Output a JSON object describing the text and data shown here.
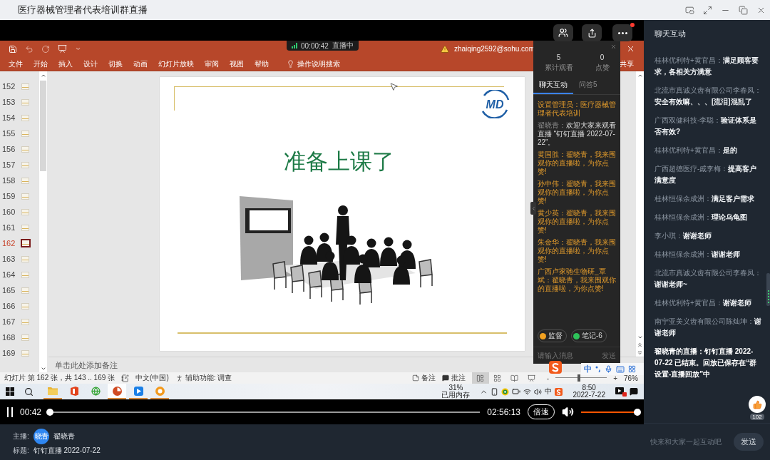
{
  "window": {
    "title": "医疗器械管理者代表培训群直播"
  },
  "video": {
    "more_unread": true,
    "live_badge": {
      "time": "00:00:42",
      "status": "直播中"
    },
    "ppt": {
      "account": "zhaiqing2592@sohu.com",
      "ribbon_tabs": [
        "文件",
        "开始",
        "插入",
        "设计",
        "切换",
        "动画",
        "幻灯片放映",
        "审阅",
        "视图",
        "帮助"
      ],
      "tell_me": "操作说明搜索",
      "share": "共享",
      "slides": [
        {
          "number": "152",
          "selected": false
        },
        {
          "number": "153",
          "selected": false
        },
        {
          "number": "154",
          "selected": false
        },
        {
          "number": "155",
          "selected": false
        },
        {
          "number": "156",
          "selected": false
        },
        {
          "number": "157",
          "selected": false
        },
        {
          "number": "158",
          "selected": false
        },
        {
          "number": "159",
          "selected": false
        },
        {
          "number": "160",
          "selected": false
        },
        {
          "number": "161",
          "selected": false
        },
        {
          "number": "162",
          "selected": true
        },
        {
          "number": "163",
          "selected": false
        },
        {
          "number": "164",
          "selected": false
        },
        {
          "number": "165",
          "selected": false
        },
        {
          "number": "166",
          "selected": false
        },
        {
          "number": "167",
          "selected": false
        },
        {
          "number": "168",
          "selected": false
        },
        {
          "number": "169",
          "selected": false
        }
      ],
      "slide": {
        "logo": "MD",
        "title": "准备上课了"
      },
      "notes_placeholder": "单击此处添加备注",
      "status": {
        "slide_info": "幻灯片 第 162 张，共 143 .. 169 张",
        "language": "中文(中国)",
        "accessibility": "辅助功能: 调查",
        "notes": "备注",
        "comments": "批注",
        "views": [
          {
            "kind": "normal",
            "selected": true
          },
          {
            "kind": "sorter",
            "selected": false
          },
          {
            "kind": "reading",
            "selected": false
          },
          {
            "kind": "show",
            "selected": false
          }
        ],
        "zoom": {
          "minus": "-",
          "plus": "+",
          "level": 0.45,
          "value": "76%"
        }
      }
    },
    "overlay": {
      "stats": [
        {
          "value": "5",
          "label": "累计观看"
        },
        {
          "value": "0",
          "label": "点赞"
        }
      ],
      "tabs": [
        {
          "label": "聊天互动",
          "selected": true
        },
        {
          "label": "问答5",
          "selected": false
        }
      ],
      "messages": [
        {
          "kind": "notice",
          "text": "设置管理员：医疗器械管理者代表培训"
        },
        {
          "kind": "welcome",
          "sender": "翟晓青：",
          "text": "欢迎大家来观看直播 “钉钉直播 2022-07-22”。"
        },
        {
          "kind": "cheer",
          "text": "黄国胜：翟晓青，我来围观你的直播啦，为你点赞!"
        },
        {
          "kind": "cheer",
          "text": "孙中伟：翟晓青，我来围观你的直播啦，为你点赞!"
        },
        {
          "kind": "cheer",
          "text": "黄少英：翟晓青，我来围观你的直播啦，为你点赞!"
        },
        {
          "kind": "cheer",
          "text": "朱金华：翟晓青，我来围观你的直播啦，为你点赞!"
        },
        {
          "kind": "cheer",
          "text": "广西卢家驰生物研_覃斌：翟晓青，我来围观你的直播啦，为你点赞!"
        }
      ],
      "chips": [
        {
          "label": "监督",
          "color": "#f0a020"
        },
        {
          "label": "笔记-6",
          "color": "#2ec25a"
        }
      ],
      "input": {
        "placeholder": "请输入消息"
      },
      "send": "发送"
    },
    "ime": {
      "mode": "中"
    },
    "taskbar": {
      "apps": [
        {
          "kind": "folder",
          "running": true,
          "active": false
        },
        {
          "kind": "tile",
          "running": false,
          "active": false
        },
        {
          "kind": "globe",
          "running": false,
          "active": false
        },
        {
          "kind": "slides",
          "running": true,
          "active": true
        },
        {
          "kind": "play",
          "running": true,
          "active": false
        },
        {
          "kind": "ring",
          "running": true,
          "active": false
        }
      ],
      "memory": {
        "percent": "31%",
        "label": "已用内存"
      },
      "ime": "中",
      "time": "8:50",
      "date": "2022-7-22"
    },
    "controls": {
      "playing": true,
      "elapsed": "00:42",
      "progress": {
        "level": 0.004
      },
      "duration": "02:56:13",
      "speed": "倍速",
      "volume": {
        "level": 1
      }
    }
  },
  "host": {
    "label": "主播:",
    "avatar": "晓青",
    "name": "翟晓青",
    "title_label": "标题:",
    "title": "钉钉直播 2022-07-22"
  },
  "chat": {
    "title": "聊天互动",
    "messages": [
      {
        "kind": "user",
        "sender": "桂林优利特+黄官昌：",
        "text": "满足顾客要求，各相关方满意"
      },
      {
        "kind": "user",
        "sender": "北流市真诚义齿有限公司李春凤：",
        "text": "安全有效嘛、、、[流泪]混乱了"
      },
      {
        "kind": "user",
        "sender": "广西双健科技-李聪：",
        "text": "验证体系是否有效?"
      },
      {
        "kind": "user",
        "sender": "桂林优利特+黄官昌：",
        "text": "是的"
      },
      {
        "kind": "user",
        "sender": "广西超德医疗-戚李梅：",
        "text": "提高客户满意度"
      },
      {
        "kind": "user",
        "sender": "桂林恒保余成洲：",
        "text": "满足客户需求"
      },
      {
        "kind": "user",
        "sender": "桂林恒保余成洲：",
        "text": "理论乌龟图"
      },
      {
        "kind": "user",
        "sender": "李小琪：",
        "text": "谢谢老师"
      },
      {
        "kind": "user",
        "sender": "桂林恒保余成洲：",
        "text": "谢谢老师"
      },
      {
        "kind": "user",
        "sender": "北流市真诚义齿有限公司李春凤：",
        "text": "谢谢老师~"
      },
      {
        "kind": "user",
        "sender": "桂林优利特+黄官昌：",
        "text": "谢谢老师"
      },
      {
        "kind": "user",
        "sender": "南宁亚美义齿有限公司陈灿坤：",
        "text": "谢谢老师"
      },
      {
        "kind": "system",
        "text": "翟晓青的直播：钉钉直播 2022-07-22 已结束。回放已保存在“群设置-直播回放”中"
      }
    ],
    "likes": "102",
    "input": {
      "placeholder": "快来和大家一起互动吧"
    },
    "send": "发送"
  }
}
